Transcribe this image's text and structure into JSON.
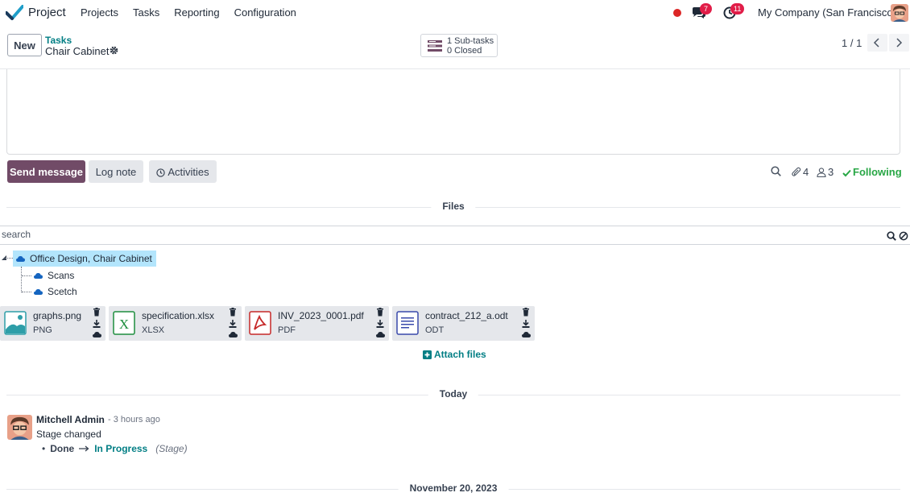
{
  "navbar": {
    "app_name": "Project",
    "menu": [
      "Projects",
      "Tasks",
      "Reporting",
      "Configuration"
    ],
    "chat_badge": "7",
    "activity_badge": "11",
    "company": "My Company (San Francisco)"
  },
  "control_panel": {
    "new_label": "New",
    "breadcrumb_parent": "Tasks",
    "breadcrumb_current": "Chair Cabinet",
    "subtasks_line1": "1 Sub-tasks",
    "subtasks_line2": "0 Closed",
    "pager": "1 / 1"
  },
  "chatter": {
    "send_message": "Send message",
    "log_note": "Log note",
    "activities": "Activities",
    "attachment_count": "4",
    "follower_count": "3",
    "following": "Following"
  },
  "files": {
    "separator": "Files",
    "search_placeholder": "search",
    "tree_root": "Office Design, Chair Cabinet",
    "tree_children": [
      "Scans",
      "Scetch"
    ],
    "attachments": [
      {
        "name": "graphs.png",
        "type": "PNG",
        "icon": "image-file-icon"
      },
      {
        "name": "specification.xlsx",
        "type": "XLSX",
        "icon": "spreadsheet-file-icon"
      },
      {
        "name": "INV_2023_0001.pdf",
        "type": "PDF",
        "icon": "pdf-file-icon"
      },
      {
        "name": "contract_212_a.odt",
        "type": "ODT",
        "icon": "document-file-icon"
      }
    ],
    "attach_files": "Attach files"
  },
  "messages": {
    "today_separator": "Today",
    "author": "Mitchell Admin",
    "time": "- 3 hours ago",
    "body": "Stage changed",
    "old_value": "Done",
    "new_value": "In Progress",
    "field": "(Stage)",
    "date_separator": "November 20, 2023"
  },
  "colors": {
    "primary": "#714b67",
    "link": "#017e84",
    "following": "#28a745",
    "badge": "#e11d48"
  }
}
